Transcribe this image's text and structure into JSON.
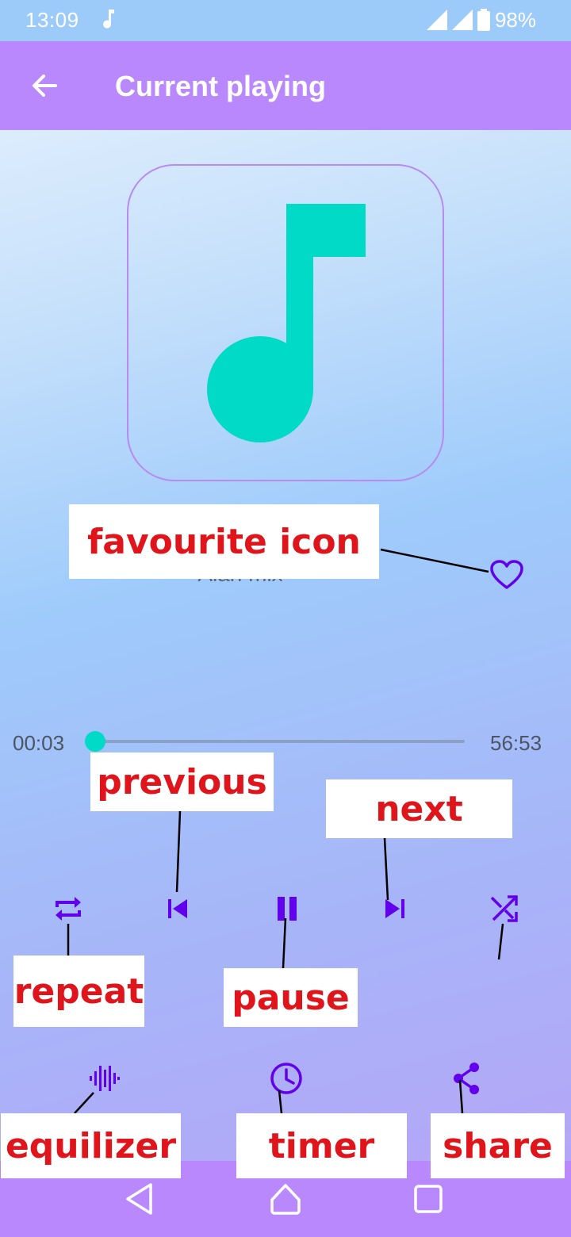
{
  "status_bar": {
    "time": "13:09",
    "battery": "98%"
  },
  "app_bar": {
    "title": "Current playing"
  },
  "song": {
    "artist": "Alan mix"
  },
  "player": {
    "elapsed": "00:03",
    "total": "56:53",
    "progress": 0.001
  },
  "annotations": {
    "favourite": "favourite icon",
    "previous": "previous",
    "next": "next",
    "repeat": "repeat",
    "pause": "pause",
    "equalizer": "equilizer",
    "timer": "timer",
    "share": "share"
  },
  "colors": {
    "accent": "#6200ee",
    "teal": "#00dac6",
    "app_bar": "#b888fc",
    "annotation_text": "#e0151b"
  },
  "icons": [
    "arrow-left-icon",
    "music-note-icon",
    "heart-icon",
    "repeat-icon",
    "skip-previous-icon",
    "pause-icon",
    "skip-next-icon",
    "shuffle-icon",
    "equalizer-icon",
    "clock-icon",
    "share-icon"
  ]
}
